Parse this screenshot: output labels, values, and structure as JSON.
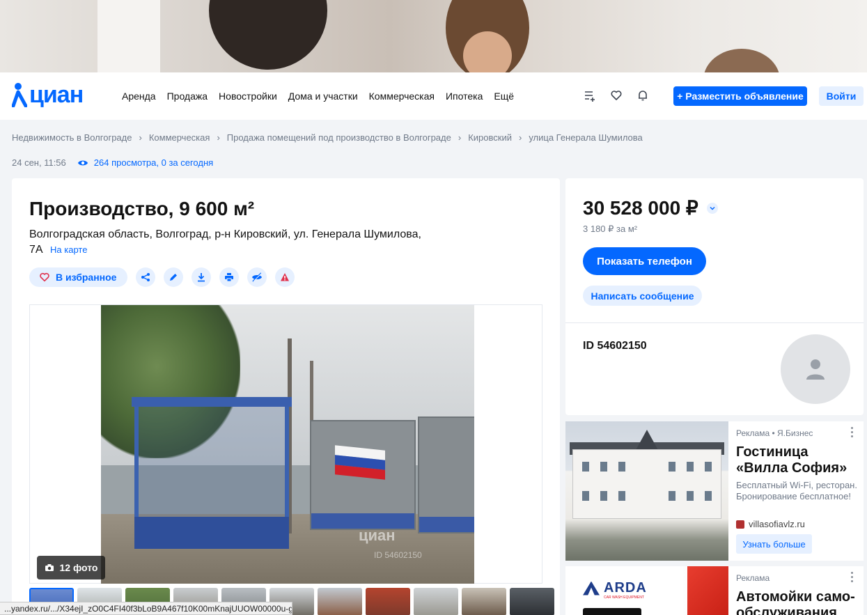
{
  "header": {
    "logo_text": "циан",
    "nav": [
      "Аренда",
      "Продажа",
      "Новостройки",
      "Дома и участки",
      "Коммерческая",
      "Ипотека",
      "Ещё"
    ],
    "post_button": "+ Разместить объявление",
    "login_button": "Войти",
    "icons": [
      "compare-list-icon",
      "heart-icon",
      "bell-icon"
    ]
  },
  "breadcrumbs": [
    "Недвижимость в Волгограде",
    "Коммерческая",
    "Продажа помещений под производство в Волгограде",
    "Кировский",
    "улица Генерала Шумилова"
  ],
  "meta": {
    "date": "24 сен, 11:56",
    "views": "264 просмотра, 0 за сегодня"
  },
  "listing": {
    "title": "Производство, 9 600 м²",
    "address_line1": "Волгоградская область, Волгоград, р-н Кировский, ул. Генерала Шумилова,",
    "address_line2": "7А",
    "map_link": "На карте",
    "favorite_button": "В избранное",
    "photo_count": "12 фото",
    "watermark": "циан",
    "watermark_id": "ID 54602150"
  },
  "price": {
    "value": "30 528 000 ₽",
    "per_meter": "3 180 ₽ за м²",
    "phone_button": "Показать телефон",
    "message_button": "Написать сообщение",
    "id": "ID 54602150"
  },
  "ads": [
    {
      "label": "Реклама • Я.Бизнес",
      "title": "Гостиница «Вилла София»",
      "text": "Бесплатный Wi-Fi, ресторан. Бронирование бесплатное!",
      "domain": "villasofiavlz.ru",
      "button": "Узнать больше"
    },
    {
      "label": "Реклама",
      "title": "Автомойки само-обслуживания",
      "brand": "ARDA",
      "brand_sub": "CAR WASH EQUIPMENT"
    }
  ],
  "status_bar": "...yandex.ru/.../X34ejI_zO0C4FI40f3bLoB9A467f10K00mKnajUUOW00000u-g...",
  "colors": {
    "brand": "#0468ff",
    "brand_light": "#e6f0ff",
    "text_muted": "#707a89",
    "page_bg": "#f2f4f7"
  }
}
